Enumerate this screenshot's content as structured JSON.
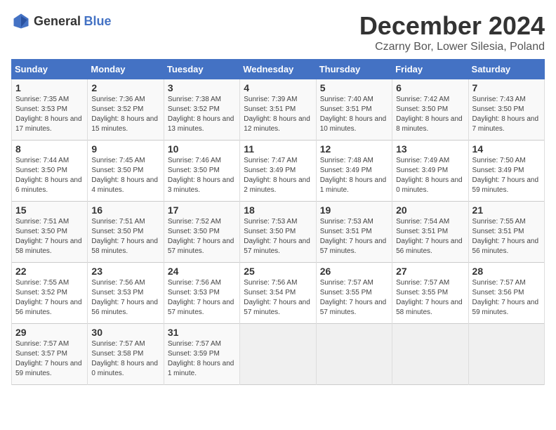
{
  "header": {
    "logo_general": "General",
    "logo_blue": "Blue",
    "month": "December 2024",
    "location": "Czarny Bor, Lower Silesia, Poland"
  },
  "weekdays": [
    "Sunday",
    "Monday",
    "Tuesday",
    "Wednesday",
    "Thursday",
    "Friday",
    "Saturday"
  ],
  "weeks": [
    [
      {
        "day": "1",
        "sunrise": "7:35 AM",
        "sunset": "3:53 PM",
        "daylight": "8 hours and 17 minutes."
      },
      {
        "day": "2",
        "sunrise": "7:36 AM",
        "sunset": "3:52 PM",
        "daylight": "8 hours and 15 minutes."
      },
      {
        "day": "3",
        "sunrise": "7:38 AM",
        "sunset": "3:52 PM",
        "daylight": "8 hours and 13 minutes."
      },
      {
        "day": "4",
        "sunrise": "7:39 AM",
        "sunset": "3:51 PM",
        "daylight": "8 hours and 12 minutes."
      },
      {
        "day": "5",
        "sunrise": "7:40 AM",
        "sunset": "3:51 PM",
        "daylight": "8 hours and 10 minutes."
      },
      {
        "day": "6",
        "sunrise": "7:42 AM",
        "sunset": "3:50 PM",
        "daylight": "8 hours and 8 minutes."
      },
      {
        "day": "7",
        "sunrise": "7:43 AM",
        "sunset": "3:50 PM",
        "daylight": "8 hours and 7 minutes."
      }
    ],
    [
      {
        "day": "8",
        "sunrise": "7:44 AM",
        "sunset": "3:50 PM",
        "daylight": "8 hours and 6 minutes."
      },
      {
        "day": "9",
        "sunrise": "7:45 AM",
        "sunset": "3:50 PM",
        "daylight": "8 hours and 4 minutes."
      },
      {
        "day": "10",
        "sunrise": "7:46 AM",
        "sunset": "3:50 PM",
        "daylight": "8 hours and 3 minutes."
      },
      {
        "day": "11",
        "sunrise": "7:47 AM",
        "sunset": "3:49 PM",
        "daylight": "8 hours and 2 minutes."
      },
      {
        "day": "12",
        "sunrise": "7:48 AM",
        "sunset": "3:49 PM",
        "daylight": "8 hours and 1 minute."
      },
      {
        "day": "13",
        "sunrise": "7:49 AM",
        "sunset": "3:49 PM",
        "daylight": "8 hours and 0 minutes."
      },
      {
        "day": "14",
        "sunrise": "7:50 AM",
        "sunset": "3:49 PM",
        "daylight": "7 hours and 59 minutes."
      }
    ],
    [
      {
        "day": "15",
        "sunrise": "7:51 AM",
        "sunset": "3:50 PM",
        "daylight": "7 hours and 58 minutes."
      },
      {
        "day": "16",
        "sunrise": "7:51 AM",
        "sunset": "3:50 PM",
        "daylight": "7 hours and 58 minutes."
      },
      {
        "day": "17",
        "sunrise": "7:52 AM",
        "sunset": "3:50 PM",
        "daylight": "7 hours and 57 minutes."
      },
      {
        "day": "18",
        "sunrise": "7:53 AM",
        "sunset": "3:50 PM",
        "daylight": "7 hours and 57 minutes."
      },
      {
        "day": "19",
        "sunrise": "7:53 AM",
        "sunset": "3:51 PM",
        "daylight": "7 hours and 57 minutes."
      },
      {
        "day": "20",
        "sunrise": "7:54 AM",
        "sunset": "3:51 PM",
        "daylight": "7 hours and 56 minutes."
      },
      {
        "day": "21",
        "sunrise": "7:55 AM",
        "sunset": "3:51 PM",
        "daylight": "7 hours and 56 minutes."
      }
    ],
    [
      {
        "day": "22",
        "sunrise": "7:55 AM",
        "sunset": "3:52 PM",
        "daylight": "7 hours and 56 minutes."
      },
      {
        "day": "23",
        "sunrise": "7:56 AM",
        "sunset": "3:53 PM",
        "daylight": "7 hours and 56 minutes."
      },
      {
        "day": "24",
        "sunrise": "7:56 AM",
        "sunset": "3:53 PM",
        "daylight": "7 hours and 57 minutes."
      },
      {
        "day": "25",
        "sunrise": "7:56 AM",
        "sunset": "3:54 PM",
        "daylight": "7 hours and 57 minutes."
      },
      {
        "day": "26",
        "sunrise": "7:57 AM",
        "sunset": "3:55 PM",
        "daylight": "7 hours and 57 minutes."
      },
      {
        "day": "27",
        "sunrise": "7:57 AM",
        "sunset": "3:55 PM",
        "daylight": "7 hours and 58 minutes."
      },
      {
        "day": "28",
        "sunrise": "7:57 AM",
        "sunset": "3:56 PM",
        "daylight": "7 hours and 59 minutes."
      }
    ],
    [
      {
        "day": "29",
        "sunrise": "7:57 AM",
        "sunset": "3:57 PM",
        "daylight": "7 hours and 59 minutes."
      },
      {
        "day": "30",
        "sunrise": "7:57 AM",
        "sunset": "3:58 PM",
        "daylight": "8 hours and 0 minutes."
      },
      {
        "day": "31",
        "sunrise": "7:57 AM",
        "sunset": "3:59 PM",
        "daylight": "8 hours and 1 minute."
      },
      null,
      null,
      null,
      null
    ]
  ]
}
